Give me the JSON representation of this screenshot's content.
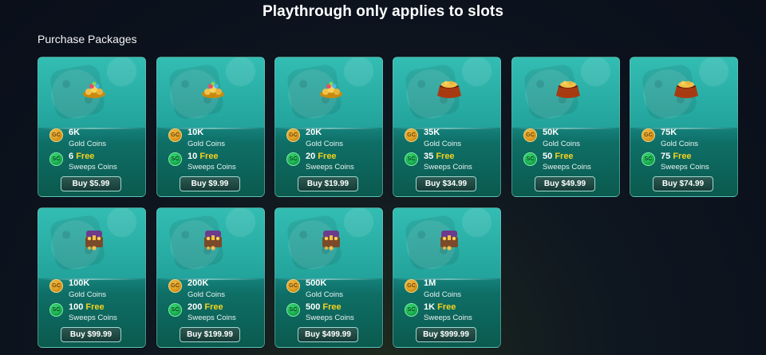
{
  "banner": "Playthrough only applies to slots",
  "section_title": "Purchase Packages",
  "labels": {
    "gold_coins": "Gold Coins",
    "sweeps_coins": "Sweeps Coins",
    "free": "Free",
    "gc_badge": "GC",
    "sc_badge": "SC"
  },
  "packages": [
    {
      "gc": "6K",
      "sc": "6",
      "buy": "Buy $5.99",
      "art": "coin-pile"
    },
    {
      "gc": "10K",
      "sc": "10",
      "buy": "Buy $9.99",
      "art": "coin-pile"
    },
    {
      "gc": "20K",
      "sc": "20",
      "buy": "Buy $19.99",
      "art": "coin-pile"
    },
    {
      "gc": "35K",
      "sc": "35",
      "buy": "Buy $34.99",
      "art": "coin-pot"
    },
    {
      "gc": "50K",
      "sc": "50",
      "buy": "Buy $49.99",
      "art": "coin-pot"
    },
    {
      "gc": "75K",
      "sc": "75",
      "buy": "Buy $74.99",
      "art": "coin-pot"
    },
    {
      "gc": "100K",
      "sc": "100",
      "buy": "Buy $99.99",
      "art": "treasure-chest"
    },
    {
      "gc": "200K",
      "sc": "200",
      "buy": "Buy $199.99",
      "art": "treasure-chest"
    },
    {
      "gc": "500K",
      "sc": "500",
      "buy": "Buy $499.99",
      "art": "treasure-chest"
    },
    {
      "gc": "1M",
      "sc": "1K",
      "buy": "Buy $999.99",
      "art": "treasure-chest"
    }
  ],
  "colors": {
    "free_accent": "#f5d21e",
    "gold_coin": "#d9971c",
    "sweeps_coin": "#17a94d",
    "card_teal": "#1f9a92"
  }
}
